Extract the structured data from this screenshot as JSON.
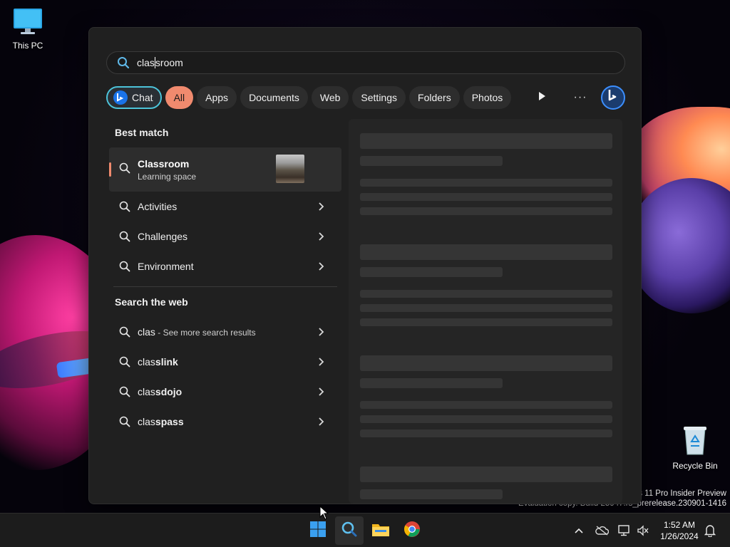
{
  "desktop": {
    "this_pc_label": "This PC",
    "recycle_bin_label": "Recycle Bin",
    "watermark_line1": "s 11 Pro Insider Preview",
    "watermark_line2": "Evaluation copy. Build 25947.rs_prerelease.230901-1416"
  },
  "search": {
    "query_before_caret": "clas",
    "query_after_caret": "sroom"
  },
  "filters": {
    "chat": "Chat",
    "all": "All",
    "apps": "Apps",
    "documents": "Documents",
    "web": "Web",
    "settings": "Settings",
    "folders": "Folders",
    "photos": "Photos",
    "more": "···"
  },
  "best_match": {
    "heading": "Best match",
    "title_bold": "Clas",
    "title_rest": "sroom",
    "subtitle": "Learning space"
  },
  "suggestions": [
    "Activities",
    "Challenges",
    "Environment"
  ],
  "web_search": {
    "heading": "Search the web",
    "first_query": "clas",
    "first_suffix": " - See more search results",
    "items": [
      {
        "prefix": "clas",
        "rest": "slink"
      },
      {
        "prefix": "clas",
        "rest": "sdojo"
      },
      {
        "prefix": "clas",
        "rest": "spass"
      }
    ]
  },
  "taskbar": {
    "time": "1:52 AM",
    "date": "1/26/2024",
    "icons": [
      "windows-start-icon",
      "search-icon",
      "file-explorer-icon",
      "chrome-icon"
    ],
    "tray_icons": [
      "chevron-up-icon",
      "onedrive-icon",
      "network-icon",
      "volume-muted-icon",
      "notification-bell-icon"
    ]
  },
  "colors": {
    "accent_orange": "#f08a6e",
    "chat_ring": "#4cc3d9",
    "panel_bg": "#202020"
  }
}
